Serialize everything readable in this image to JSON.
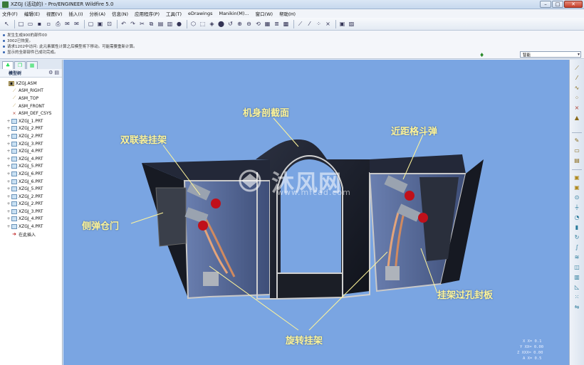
{
  "window": {
    "title": "XZGJ (活动的) - Pro/ENGINEER Wildfire 5.0",
    "min": "–",
    "max": "□",
    "close": "✕"
  },
  "menu": [
    "文件(F)",
    "编辑(E)",
    "视图(V)",
    "插入(I)",
    "分析(A)",
    "信息(N)",
    "应用程序(P)",
    "工具(T)",
    "eDrawings",
    "Manikin(M)...",
    "窗口(W)",
    "帮助(H)"
  ],
  "messages": [
    "发生生成900的部件00",
    "3002已恢复。",
    "请求1202中访问: 此元素属性计算之后模型将下移动。可能需要重新计算。",
    "显示的全部部件已成功完成。"
  ],
  "filter": {
    "value": "智能"
  },
  "model_tree": {
    "tabs": [
      "tree-tab",
      "layers-tab",
      "folder-tab"
    ],
    "header": "模型树",
    "rows": [
      {
        "label": "XZGJ.ASM",
        "icon": "asm",
        "indent": 0,
        "exp": ""
      },
      {
        "label": "ASM_RIGHT",
        "icon": "plane",
        "indent": 1,
        "exp": ""
      },
      {
        "label": "ASM_TOP",
        "icon": "plane",
        "indent": 1,
        "exp": ""
      },
      {
        "label": "ASM_FRONT",
        "icon": "plane",
        "indent": 1,
        "exp": ""
      },
      {
        "label": "ASM_DEF_CSYS",
        "icon": "csys",
        "indent": 1,
        "exp": ""
      },
      {
        "label": "XZGJ_1.PRT",
        "icon": "part",
        "indent": 1,
        "exp": "+"
      },
      {
        "label": "XZGJ_2.PRT",
        "icon": "part",
        "indent": 1,
        "exp": "+"
      },
      {
        "label": "XZGJ_2.PRT",
        "icon": "part",
        "indent": 1,
        "exp": "+"
      },
      {
        "label": "XZGJ_3.PRT",
        "icon": "part",
        "indent": 1,
        "exp": "+"
      },
      {
        "label": "XZGJ_4.PRT",
        "icon": "part",
        "indent": 1,
        "exp": "+"
      },
      {
        "label": "XZGJ_4.PRT",
        "icon": "part",
        "indent": 1,
        "exp": "+"
      },
      {
        "label": "XZGJ_5.PRT",
        "icon": "part",
        "indent": 1,
        "exp": "+"
      },
      {
        "label": "XZGJ_6.PRT",
        "icon": "part",
        "indent": 1,
        "exp": "+"
      },
      {
        "label": "XZGJ_6.PRT",
        "icon": "part",
        "indent": 1,
        "exp": "+"
      },
      {
        "label": "XZGJ_5.PRT",
        "icon": "part",
        "indent": 1,
        "exp": "+"
      },
      {
        "label": "XZGJ_2.PRT",
        "icon": "part",
        "indent": 1,
        "exp": "+"
      },
      {
        "label": "XZGJ_2.PRT",
        "icon": "part",
        "indent": 1,
        "exp": "+"
      },
      {
        "label": "XZGJ_3.PRT",
        "icon": "part",
        "indent": 1,
        "exp": "+"
      },
      {
        "label": "XZGJ_4.PRT",
        "icon": "part",
        "indent": 1,
        "exp": "+"
      },
      {
        "label": "XZGJ_4.PRT",
        "icon": "part",
        "indent": 1,
        "exp": "+"
      },
      {
        "label": "在此插入",
        "icon": "insert",
        "indent": 1,
        "exp": ""
      }
    ]
  },
  "annotations": {
    "fuselage_section": "机身剖截面",
    "dual_rack": "双联装挂架",
    "close_missile": "近距格斗弹",
    "side_bay_door": "侧弹仓门",
    "rack_hole_plate": "挂架过孔封板",
    "rotary_rack": "旋转挂架"
  },
  "watermark": {
    "main": "沐风网",
    "sub": "www.mfcad.com"
  },
  "coords": [
    "X X= 0.1",
    "Y XX= 0.00",
    "Z XXX= 0.00",
    "A X= 0.5"
  ],
  "colors": {
    "viewport_bg": "#7aa5e2",
    "annotation": "#fff59a",
    "body": "#1d2230",
    "panel_edge": "#c9c9c9"
  }
}
